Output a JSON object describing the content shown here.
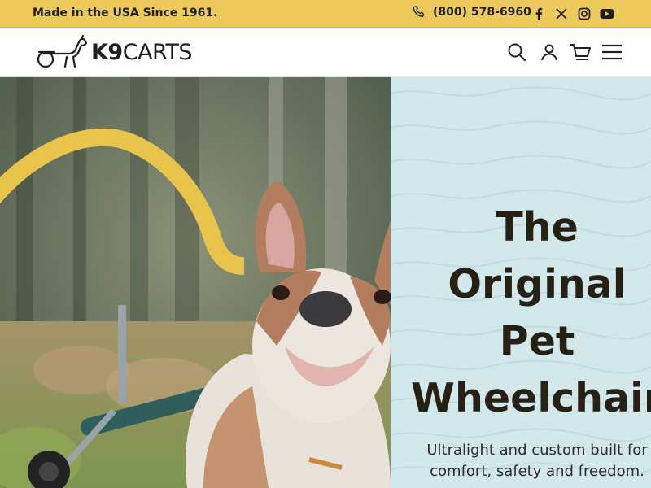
{
  "topbar": {
    "tagline": "Made in the USA Since 1961.",
    "phone": "(800) 578-6960",
    "social": [
      "facebook-icon",
      "x-icon",
      "instagram-icon",
      "youtube-icon"
    ],
    "background": "#ecc95a"
  },
  "header": {
    "logo_bold": "K9",
    "logo_text": "CARTS",
    "icons": [
      "search-icon",
      "account-icon",
      "cart-icon",
      "menu-icon"
    ]
  },
  "hero": {
    "headline": [
      "The",
      "Original",
      "Pet",
      "Wheelchair"
    ],
    "subtitle": [
      "Ultralight and custom built for",
      "comfort, safety and freedom."
    ],
    "panel_color": "#d3e8ea",
    "accent_color": "#e8c44c"
  }
}
